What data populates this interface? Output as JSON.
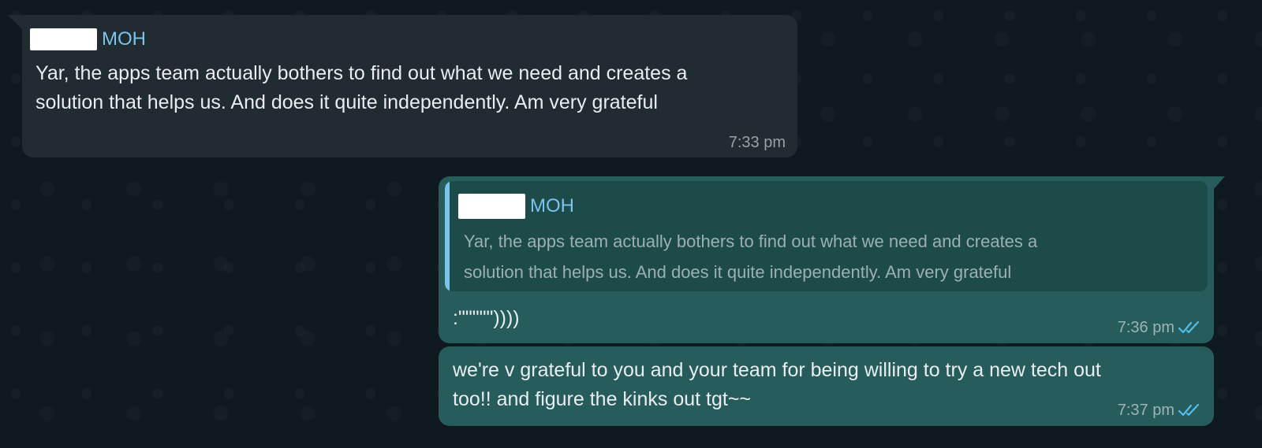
{
  "messages": [
    {
      "sender": "MOH",
      "text_line1": "Yar, the apps team actually bothers to find out what we need and creates a",
      "text_line2": "solution that helps us. And does it quite independently. Am very grateful",
      "time": "7:33 pm"
    },
    {
      "quoted_sender": "MOH",
      "quoted_line1": "Yar, the apps team actually bothers to find out what we need and creates a",
      "quoted_line2": "solution that helps us. And does it quite independently. Am very grateful",
      "text": ":\"\"\"\"\"))))",
      "time": "7:36 pm",
      "status": "read"
    },
    {
      "text_line1": "we're v grateful to you and your team for being willing to try a new tech out",
      "text_line2": "too!! and figure the kinks out tgt~~",
      "time": "7:37 pm",
      "status": "read"
    }
  ],
  "colors": {
    "background": "#0f1a20",
    "incoming_bubble": "#212b32",
    "outgoing_bubble": "#275c5c",
    "quote_bg": "#1d4b4a",
    "sender_name": "#7cc3ea",
    "read_ticks": "#53bdeb"
  },
  "icons": {
    "read_status": "double-check-icon"
  }
}
